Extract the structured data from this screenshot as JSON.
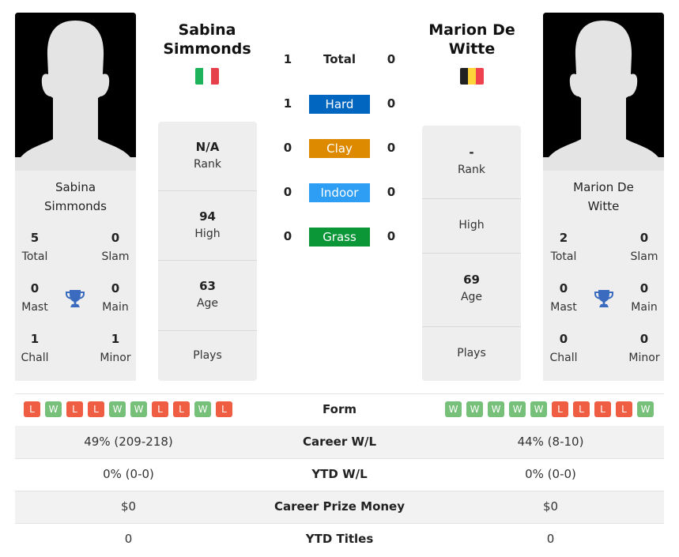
{
  "player1": {
    "name": "Sabina Simmonds",
    "name_line1": "Sabina",
    "name_line2": "Simmonds",
    "flag": {
      "country": "Italy",
      "colors": [
        "#1db35a",
        "#ffffff",
        "#e5404c"
      ]
    },
    "titles": {
      "total": {
        "value": "5",
        "label": "Total"
      },
      "slam": {
        "value": "0",
        "label": "Slam"
      },
      "mast": {
        "value": "0",
        "label": "Mast"
      },
      "main": {
        "value": "0",
        "label": "Main"
      },
      "chall": {
        "value": "1",
        "label": "Chall"
      },
      "minor": {
        "value": "1",
        "label": "Minor"
      }
    },
    "rank": {
      "value": "N/A",
      "label": "Rank"
    },
    "high": {
      "value": "94",
      "label": "High"
    },
    "age": {
      "value": "63",
      "label": "Age"
    },
    "plays": {
      "value": "",
      "label": "Plays"
    },
    "form": [
      "L",
      "W",
      "L",
      "L",
      "W",
      "W",
      "L",
      "L",
      "W",
      "L"
    ]
  },
  "player2": {
    "name": "Marion De Witte",
    "name_line1": "Marion De",
    "name_line2": "Witte",
    "flag": {
      "country": "Belgium",
      "colors": [
        "#222222",
        "#fdd43a",
        "#f0414f"
      ]
    },
    "titles": {
      "total": {
        "value": "2",
        "label": "Total"
      },
      "slam": {
        "value": "0",
        "label": "Slam"
      },
      "mast": {
        "value": "0",
        "label": "Mast"
      },
      "main": {
        "value": "0",
        "label": "Main"
      },
      "chall": {
        "value": "0",
        "label": "Chall"
      },
      "minor": {
        "value": "0",
        "label": "Minor"
      }
    },
    "rank": {
      "value": "-",
      "label": "Rank"
    },
    "high": {
      "value": "",
      "label": "High"
    },
    "age": {
      "value": "69",
      "label": "Age"
    },
    "plays": {
      "value": "",
      "label": "Plays"
    },
    "form": [
      "W",
      "W",
      "W",
      "W",
      "W",
      "L",
      "L",
      "L",
      "L",
      "W"
    ]
  },
  "h2h": [
    {
      "label": "Total",
      "p1": "1",
      "p2": "0",
      "color": null
    },
    {
      "label": "Hard",
      "p1": "1",
      "p2": "0",
      "color": "#0066c0"
    },
    {
      "label": "Clay",
      "p1": "0",
      "p2": "0",
      "color": "#dd8a00"
    },
    {
      "label": "Indoor",
      "p1": "0",
      "p2": "0",
      "color": "#2e9ef4"
    },
    {
      "label": "Grass",
      "p1": "0",
      "p2": "0",
      "color": "#0b9638"
    }
  ],
  "comparison": {
    "form_label": "Form",
    "rows": [
      {
        "label": "Career W/L",
        "p1": "49% (209-218)",
        "p2": "44% (8-10)"
      },
      {
        "label": "YTD W/L",
        "p1": "0% (0-0)",
        "p2": "0% (0-0)"
      },
      {
        "label": "Career Prize Money",
        "p1": "$0",
        "p2": "$0"
      },
      {
        "label": "YTD Titles",
        "p1": "0",
        "p2": "0"
      }
    ]
  },
  "icons": {
    "trophy": "trophy-icon",
    "avatar": "silhouette-avatar"
  },
  "colors": {
    "win": "#77c07a",
    "loss": "#ef5d42",
    "trophy": "#3a6bbf",
    "panel": "#eeeeee"
  }
}
